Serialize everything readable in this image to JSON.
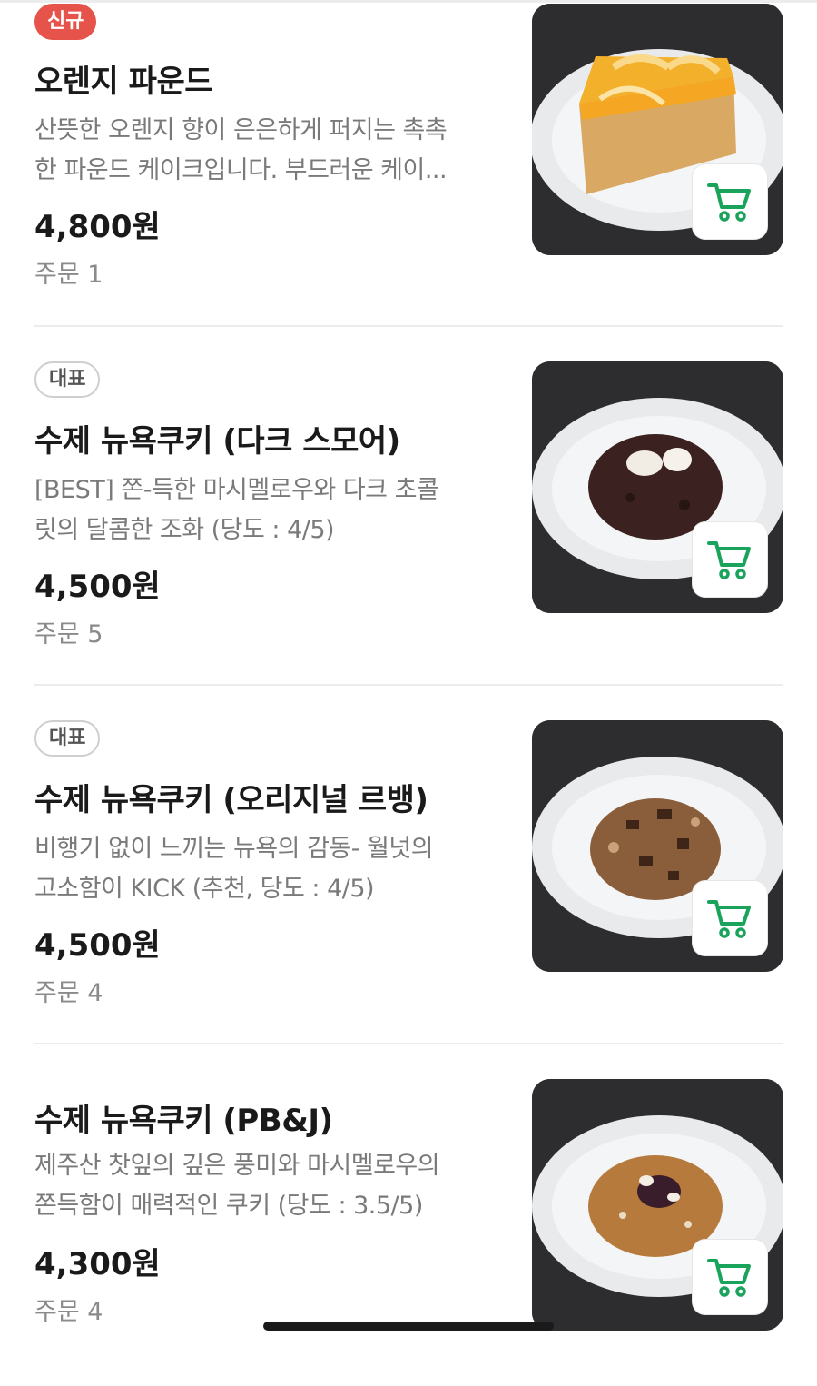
{
  "items": [
    {
      "badge": "신규",
      "title": "오렌지 파운드",
      "desc_line1": "산뜻한 오렌지 향이 은은하게 퍼지는 촉촉",
      "desc_line2": "한 파운드 케이크입니다. 부드러운 케이...",
      "price": "4,800원",
      "orders": "주문 1"
    },
    {
      "badge": "대표",
      "title": "수제 뉴욕쿠키 (다크 스모어)",
      "desc_line1": "[BEST] 쫀-득한 마시멜로우와 다크 초콜",
      "desc_line2": "릿의 달콤한 조화 (당도 : 4/5)",
      "price": "4,500원",
      "orders": "주문 5"
    },
    {
      "badge": "대표",
      "title": "수제 뉴욕쿠키 (오리지널 르뱅)",
      "desc_line1": "비행기 없이 느끼는 뉴욕의 감동- 월넛의",
      "desc_line2": "고소함이 KICK (추천, 당도 : 4/5)",
      "price": "4,500원",
      "orders": "주문 4"
    },
    {
      "badge": "",
      "title": "수제 뉴욕쿠키 (PB&J)",
      "desc_line1": "제주산 찻잎의 깊은 풍미와 마시멜로우의",
      "desc_line2": "쫀득함이 매력적인 쿠키 (당도 : 3.5/5)",
      "price": "4,300원",
      "orders": "주문 4"
    }
  ],
  "colors": {
    "new_badge": "#e5534b",
    "cart_icon": "#1aa35a",
    "thumb_bg": "#2d2d2f"
  },
  "icons": {
    "cart": "shopping-cart-icon"
  }
}
